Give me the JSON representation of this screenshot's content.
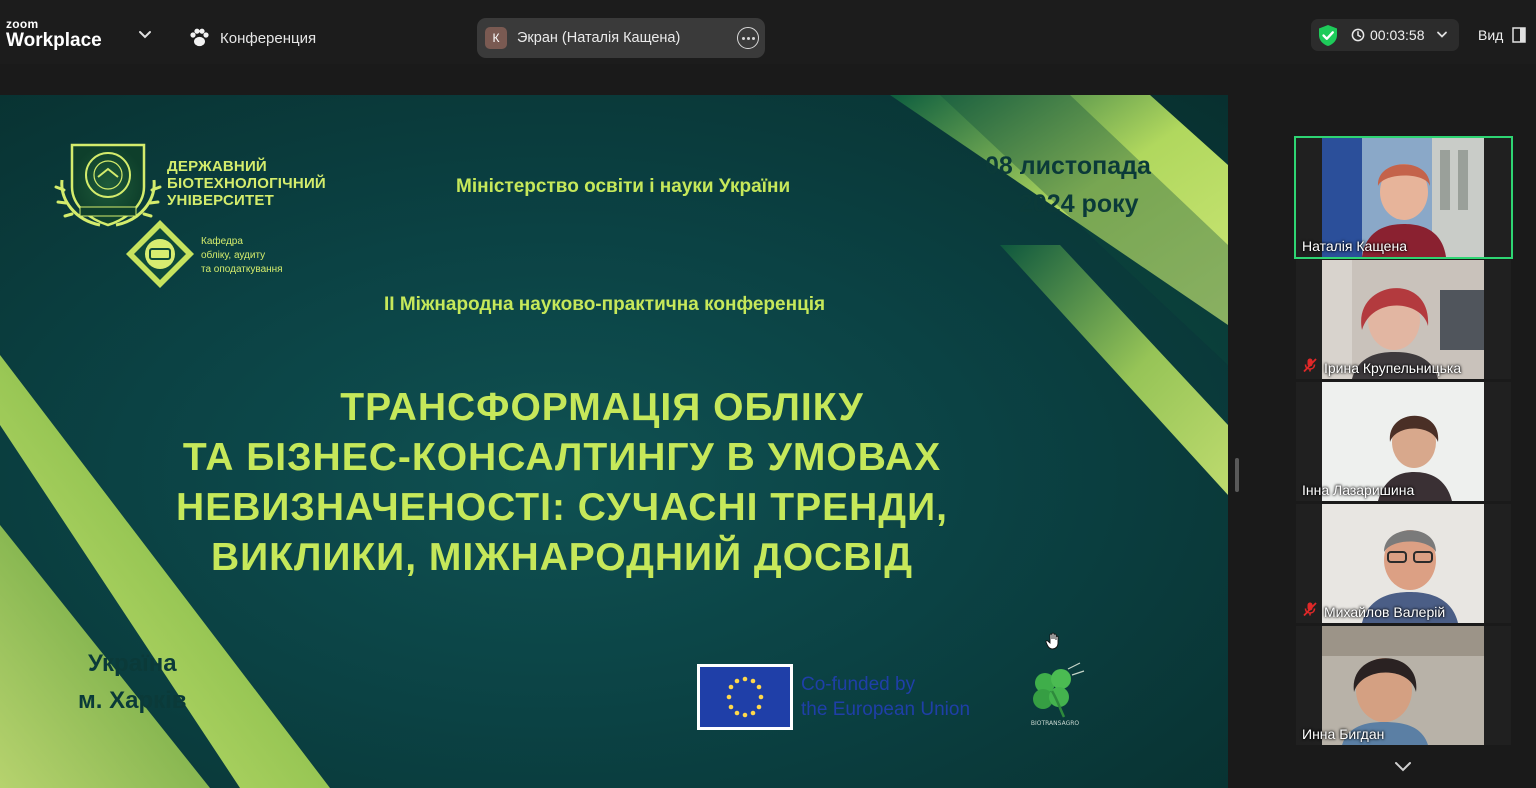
{
  "app": {
    "brand_small": "zoom",
    "brand_big": "Workplace",
    "meeting_tab": "Конференция",
    "share": {
      "avatar_letter": "К",
      "label": "Экран (Наталія Кащена)"
    },
    "timer": "00:03:58",
    "view_label": "Вид",
    "colors": {
      "topbar": "#1c1c1c",
      "active_speaker": "#2ed573",
      "shield": "#1ecb5a"
    }
  },
  "slide": {
    "university": [
      "ДЕРЖАВНИЙ",
      "БІОТЕХНОЛОГІЧНИЙ",
      "УНІВЕРСИТЕТ"
    ],
    "department": [
      "Кафедра",
      "обліку, аудиту",
      "та оподаткування"
    ],
    "ministry": "Міністерство освіти і науки України",
    "date_line1": "08 листопада",
    "date_line2": "2024 року",
    "conference": "ІІ Міжнародна науково-практична конференція",
    "title_lines": [
      "ТРАНСФОРМАЦІЯ ОБЛІКУ",
      "ТА БІЗНЕС-КОНСАЛТИНГУ В УМОВАХ",
      "НЕВИЗНАЧЕНОСТІ: СУЧАСНІ ТРЕНДИ,",
      "ВИКЛИКИ, МІЖНАРОДНИЙ ДОСВІД"
    ],
    "place_line1": "Україна",
    "place_line2": "м. Харків",
    "eu_text": [
      "Co-funded by",
      "the European Union"
    ],
    "partner_logo_text": "BIOTRANSAGRO",
    "colors": {
      "bg": "#0b4244",
      "accent": "#c6e85a",
      "dark_text": "#0b3a39",
      "eu_blue": "#1f3fa8"
    }
  },
  "participants": [
    {
      "name": "Наталія Кащена",
      "muted": false,
      "active": true
    },
    {
      "name": "Ірина Крупельницька",
      "muted": true,
      "active": false
    },
    {
      "name": "Інна Лазаришина",
      "muted": false,
      "active": false
    },
    {
      "name": "Михайлов Валерій",
      "muted": true,
      "active": false
    },
    {
      "name": "Инна Бигдан",
      "muted": false,
      "active": false
    }
  ]
}
